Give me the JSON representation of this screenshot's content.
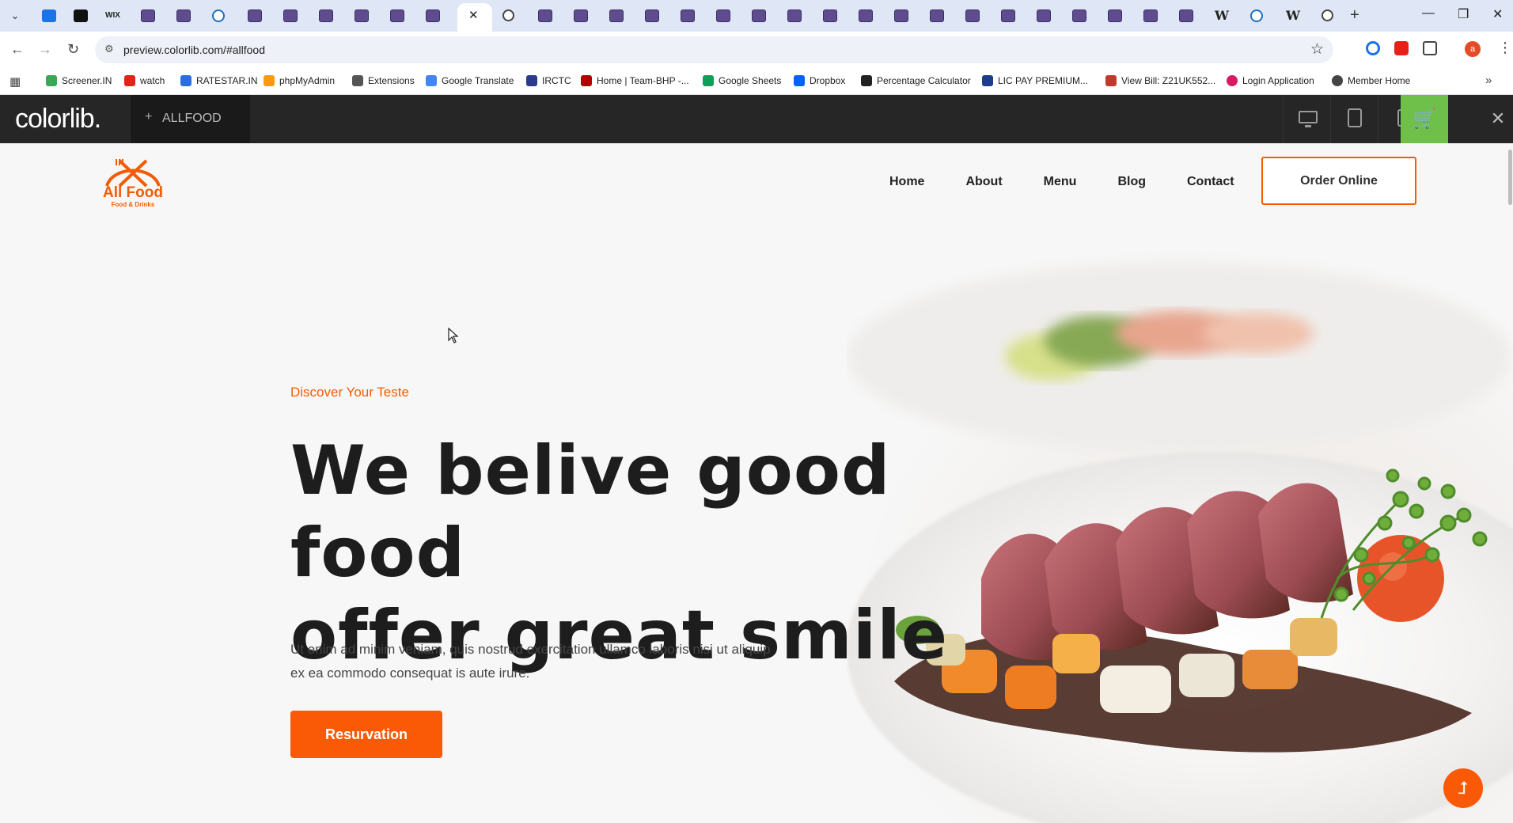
{
  "browser": {
    "url": "preview.colorlib.com/#allfood",
    "bookmarks": [
      {
        "label": "Screener.IN",
        "color": "#3aa757"
      },
      {
        "label": "watch",
        "color": "#e62117"
      },
      {
        "label": "RATESTAR.IN",
        "color": "#2a6fdb"
      },
      {
        "label": "phpMyAdmin",
        "color": "#f89c0e"
      },
      {
        "label": "Extensions",
        "color": "#555555"
      },
      {
        "label": "Google Translate",
        "color": "#4285f4"
      },
      {
        "label": "IRCTC",
        "color": "#2b3a8c"
      },
      {
        "label": "Home | Team-BHP -...",
        "color": "#b30000"
      },
      {
        "label": "Google Sheets",
        "color": "#0f9d58"
      },
      {
        "label": "Dropbox",
        "color": "#0061ff"
      },
      {
        "label": "Percentage Calculator",
        "color": "#222222"
      },
      {
        "label": "LIC PAY PREMIUM...",
        "color": "#1e3c8c"
      },
      {
        "label": "View Bill: Z21UK552...",
        "color": "#c0392b"
      },
      {
        "label": "Login Application",
        "color": "#d81b60"
      },
      {
        "label": "Member Home",
        "color": "#444444"
      }
    ],
    "profile_initial": "a"
  },
  "preview_bar": {
    "logo": "colorlib.",
    "theme_name": "ALLFOOD",
    "accent": "#6fc04b"
  },
  "site": {
    "logo_title": "All Food",
    "logo_subtitle": "Food & Drinks",
    "nav": [
      "Home",
      "About",
      "Menu",
      "Blog",
      "Contact"
    ],
    "order_button": "Order Online",
    "kicker": "Discover Your Teste",
    "headline_line1": "We belive good food",
    "headline_line2": "offer great smile",
    "body": "Ut enim ad minim veniam, quis nostrud exercitation ullamco laboris nisi ut aliquip ex ea commodo consequat is aute irure.",
    "cta": "Resurvation",
    "accent": "#fa5a06"
  }
}
